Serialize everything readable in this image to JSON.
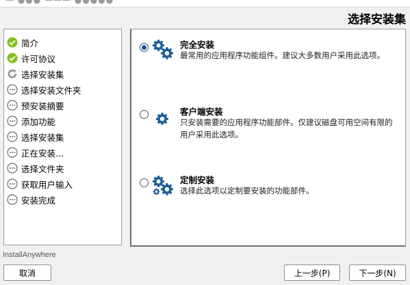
{
  "page_heading": "选择安装集",
  "steps": [
    {
      "label": "简介",
      "status": "done"
    },
    {
      "label": "许可协议",
      "status": "done"
    },
    {
      "label": "选择安装集",
      "status": "current"
    },
    {
      "label": "选择安装文件夹",
      "status": "pending"
    },
    {
      "label": "预安装摘要",
      "status": "pending"
    },
    {
      "label": "添加功能",
      "status": "pending"
    },
    {
      "label": "选择安装集",
      "status": "pending"
    },
    {
      "label": "正在安装...",
      "status": "pending"
    },
    {
      "label": "选择文件夹",
      "status": "pending"
    },
    {
      "label": "获取用户输入",
      "status": "pending"
    },
    {
      "label": "安装完成",
      "status": "pending"
    }
  ],
  "options": [
    {
      "title": "完全安装",
      "desc": "最常用的应用程序功能组件。建议大多数用户采用此选项。",
      "selected": true,
      "icon": "gears-icon"
    },
    {
      "title": "客户端安装",
      "desc": "只安装需要的应用程序功能部件。仅建议磁盘可用空间有限的用户采用此选项。",
      "selected": false,
      "icon": "gear-icon"
    },
    {
      "title": "定制安装",
      "desc": "选择此选项以定制要安装的功能部件。",
      "selected": false,
      "icon": "gears-icon"
    }
  ],
  "brand": "InstallAnywhere",
  "buttons": {
    "cancel": "取消",
    "previous": "上一步(P)",
    "next": "下一步(N)"
  },
  "colors": {
    "check_green": "#7fc31c",
    "gear_blue": "#1d5f9e",
    "radio_blue": "#1d4f91"
  }
}
